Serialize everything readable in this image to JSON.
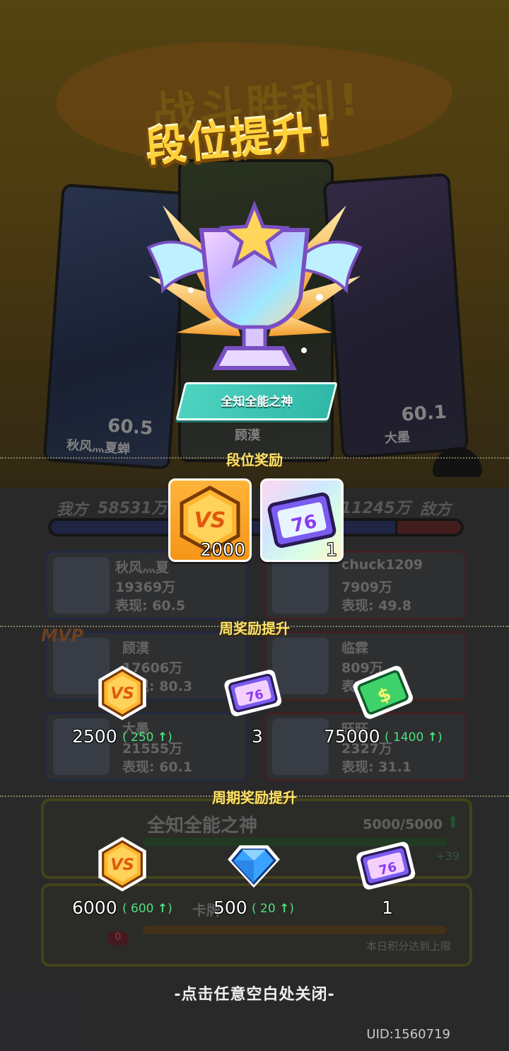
{
  "background": {
    "title": "战斗胜利!",
    "cards": [
      {
        "name": "秋风灬夏蝉",
        "score": "60.5"
      },
      {
        "name": "顾漠",
        "score": ""
      },
      {
        "name": "大墨",
        "score": "60.1"
      }
    ],
    "our_label": "我方",
    "our_score": "58531万",
    "enemy_score": "11245万",
    "enemy_label": "敌方",
    "team_blue_fraction": 0.84,
    "players": [
      {
        "name": "秋风灬夏",
        "power": "19369万",
        "perf": "表现: 60.5",
        "side": "ally"
      },
      {
        "name": "chuck1209",
        "power": "7909万",
        "perf": "表现: 49.8",
        "side": "enemy"
      },
      {
        "name": "顾漠",
        "power": "17606万",
        "perf": "表现: 80.3",
        "side": "ally"
      },
      {
        "name": "临霖",
        "power": "809万",
        "perf": "表",
        "side": "enemy"
      },
      {
        "name": "大墨",
        "power": "21555万",
        "perf": "表现: 60.1",
        "side": "ally"
      },
      {
        "name": "旺旺",
        "power": "2327万",
        "perf": "表现: 31.1",
        "side": "enemy"
      }
    ],
    "mvp": "MVP",
    "rank_panel": {
      "name": "全知全能之神",
      "progress": "5000/5000",
      "extra": "+39",
      "progress_fraction": 1.0
    },
    "card_panel": {
      "label": "卡牌",
      "note": "本日积分达到上限",
      "badge": "0"
    }
  },
  "popup": {
    "title": "段位提升!",
    "rank_name": "全知全能之神",
    "rank_reward_title": "段位奖励",
    "rank_rewards": [
      {
        "icon": "vs-coin-icon",
        "qty": "2000"
      },
      {
        "icon": "ticket-card-icon",
        "qty": "1"
      }
    ],
    "weekly_title": "周奖励提升",
    "weekly_rewards": [
      {
        "icon": "vs-coin-icon",
        "qty": "2500",
        "inc": "250"
      },
      {
        "icon": "ticket-card-icon",
        "qty": "3",
        "inc": ""
      },
      {
        "icon": "cash-icon",
        "qty": "75000",
        "inc": "1400"
      }
    ],
    "cycle_title": "周期奖励提升",
    "cycle_rewards": [
      {
        "icon": "vs-coin-icon",
        "qty": "6000",
        "inc": "600"
      },
      {
        "icon": "diamond-icon",
        "qty": "500",
        "inc": "20"
      },
      {
        "icon": "ticket-card-icon",
        "qty": "1",
        "inc": ""
      }
    ],
    "close_hint": "-点击任意空白处关闭-",
    "uid": "UID:1560719"
  },
  "colors": {
    "accent_yellow": "#ffe36a",
    "increase_green": "#4ee07a",
    "banner_teal": "#2fb8a8"
  }
}
